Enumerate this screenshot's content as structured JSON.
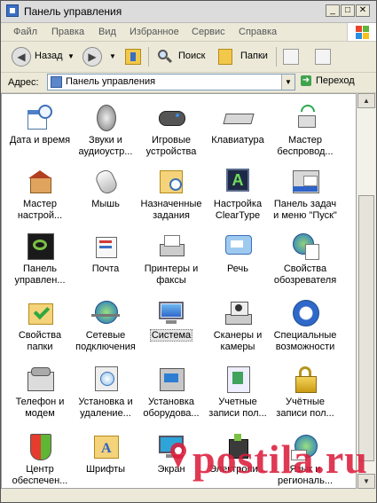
{
  "window": {
    "title": "Панель управления"
  },
  "menu": [
    "Файл",
    "Правка",
    "Вид",
    "Избранное",
    "Сервис",
    "Справка"
  ],
  "toolbar": {
    "back": "Назад",
    "search": "Поиск",
    "folders": "Папки"
  },
  "address": {
    "label": "Адрес:",
    "value": "Панель управления",
    "go": "Переход"
  },
  "items": [
    {
      "label": "Дата и время",
      "icon": "calendar-clock-icon"
    },
    {
      "label": "Звуки и аудиоустр...",
      "icon": "speaker-icon"
    },
    {
      "label": "Игровые устройства",
      "icon": "gamepad-icon"
    },
    {
      "label": "Клавиатура",
      "icon": "keyboard-icon"
    },
    {
      "label": "Мастер беспровод...",
      "icon": "wireless-icon"
    },
    {
      "label": "Мастер настрой...",
      "icon": "network-house-icon"
    },
    {
      "label": "Мышь",
      "icon": "mouse-icon"
    },
    {
      "label": "Назначенные задания",
      "icon": "scheduled-folder-icon"
    },
    {
      "label": "Настройка ClearType",
      "icon": "cleartype-icon"
    },
    {
      "label": "Панель задач и меню \"Пуск\"",
      "icon": "taskbar-icon"
    },
    {
      "label": "Панель управлен...",
      "icon": "nvidia-icon"
    },
    {
      "label": "Почта",
      "icon": "mail-icon"
    },
    {
      "label": "Принтеры и факсы",
      "icon": "printer-icon"
    },
    {
      "label": "Речь",
      "icon": "speech-icon"
    },
    {
      "label": "Свойства обозревателя",
      "icon": "internet-options-icon"
    },
    {
      "label": "Свойства папки",
      "icon": "folder-check-icon"
    },
    {
      "label": "Сетевые подключения",
      "icon": "network-globe-icon"
    },
    {
      "label": "Система",
      "icon": "system-icon",
      "selected": true
    },
    {
      "label": "Сканеры и камеры",
      "icon": "scanner-camera-icon"
    },
    {
      "label": "Специальные возможности",
      "icon": "accessibility-icon"
    },
    {
      "label": "Телефон и модем",
      "icon": "phone-modem-icon"
    },
    {
      "label": "Установка и удаление...",
      "icon": "add-remove-icon"
    },
    {
      "label": "Установка оборудова...",
      "icon": "hardware-icon"
    },
    {
      "label": "Учетные записи пол...",
      "icon": "user-accounts-icon"
    },
    {
      "label": "Учётные записи пол...",
      "icon": "lock-icon"
    },
    {
      "label": "Центр обеспечен...",
      "icon": "security-shield-icon"
    },
    {
      "label": "Шрифты",
      "icon": "fonts-folder-icon"
    },
    {
      "label": "Экран",
      "icon": "display-icon"
    },
    {
      "label": "Электропи...",
      "icon": "power-icon"
    },
    {
      "label": "Язык и региональ...",
      "icon": "regional-globe-icon"
    }
  ],
  "watermark": "postila.ru"
}
